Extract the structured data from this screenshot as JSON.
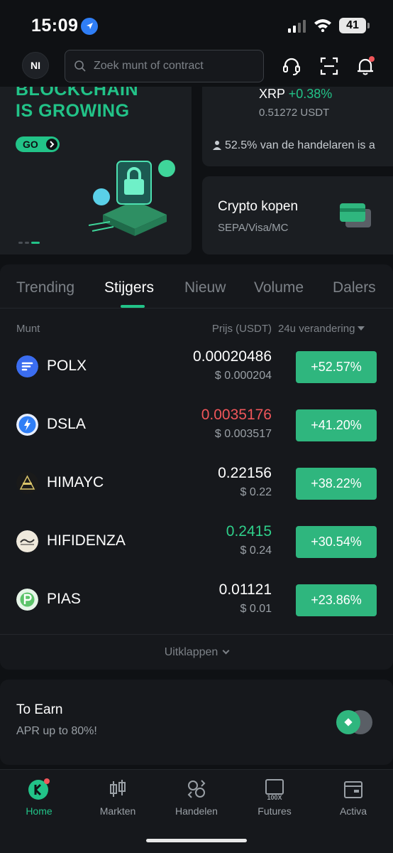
{
  "status": {
    "time": "15:09",
    "battery": "41"
  },
  "header": {
    "avatar": "NI",
    "search_placeholder": "Zoek munt of contract"
  },
  "banner": {
    "title_cut": "BLOCKCHAIN",
    "title": "IS GROWING",
    "go": "GO"
  },
  "xrp": {
    "symbol": "XRP",
    "change": "+0.38%",
    "price": "0.51272 USDT",
    "ticker": "52.5% van de handelaren is a"
  },
  "buy": {
    "title": "Crypto kopen",
    "subtitle": "SEPA/Visa/MC"
  },
  "tabs": [
    "Trending",
    "Stijgers",
    "Nieuw",
    "Volume",
    "Dalers"
  ],
  "table": {
    "col_coin": "Munt",
    "col_price": "Prijs (USDT)",
    "col_change": "24u verandering"
  },
  "rows": [
    {
      "name": "POLX",
      "price": "0.00020486",
      "usd": "$ 0.000204",
      "change": "+52.57%",
      "price_color": "white",
      "logo_color": "#3b6df0"
    },
    {
      "name": "DSLA",
      "price": "0.0035176",
      "usd": "$ 0.003517",
      "change": "+41.20%",
      "price_color": "red",
      "logo_color": "#2f7ef6"
    },
    {
      "name": "HIMAYC",
      "price": "0.22156",
      "usd": "$ 0.22",
      "change": "+38.22%",
      "price_color": "white",
      "logo_color": "#1a1a1a"
    },
    {
      "name": "HIFIDENZA",
      "price": "0.2415",
      "usd": "$ 0.24",
      "change": "+30.54%",
      "price_color": "green",
      "logo_color": "#efe9dc"
    },
    {
      "name": "PIAS",
      "price": "0.01121",
      "usd": "$ 0.01",
      "change": "+23.86%",
      "price_color": "white",
      "logo_color": "#5cc46a"
    }
  ],
  "collapse": "Uitklappen",
  "earn": {
    "title": "To Earn",
    "subtitle": "APR up to 80%!"
  },
  "nav": [
    "Home",
    "Markten",
    "Handelen",
    "Futures",
    "Activa"
  ],
  "colors": {
    "accent": "#22c388",
    "up": "#2fb67e",
    "down": "#f0565a",
    "background": "#0f1114",
    "card": "#1b1e22"
  }
}
